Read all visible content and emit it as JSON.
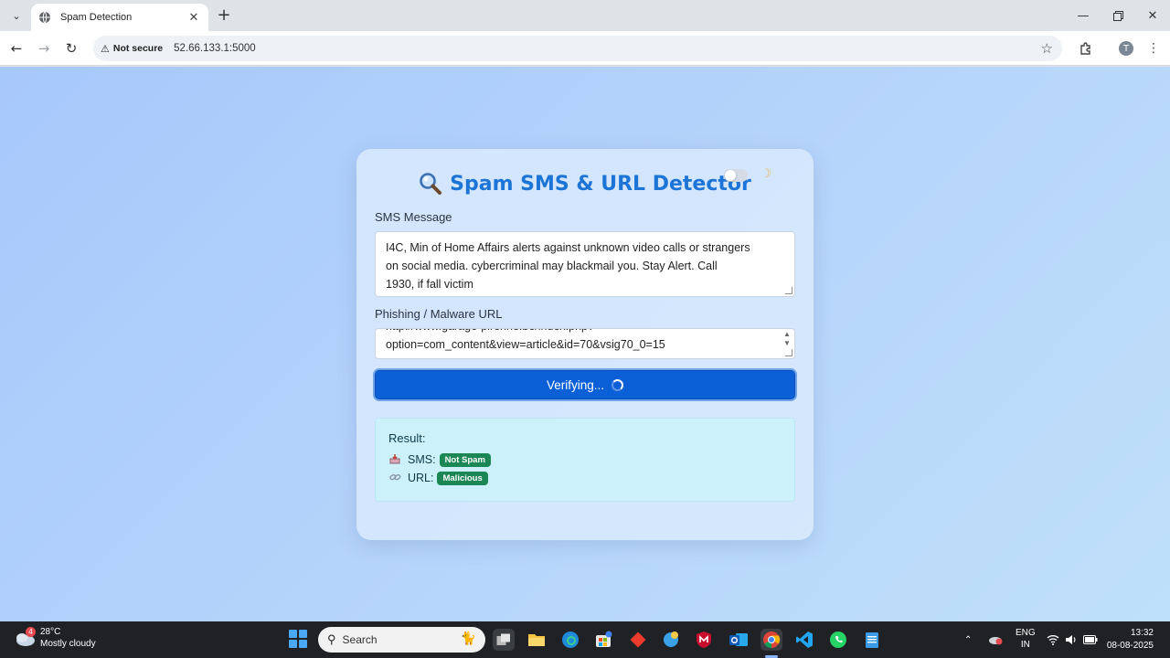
{
  "browser": {
    "tab_title": "Spam Detection",
    "security_label": "Not secure",
    "address": "52.66.133.1:5000",
    "profile_initial": "T"
  },
  "app": {
    "title": "Spam SMS & URL Detector",
    "sms_label": "SMS Message",
    "sms_value_lines": [
      "I4C, Min of Home Affairs alerts against unknown video calls or strangers",
      "on social media. cybercriminal may blackmail you. Stay Alert. Call",
      "1930, if fall victim"
    ],
    "url_label": "Phishing / Malware URL",
    "url_value_lines": [
      "http://www.garage-pirenne.be/index.php?",
      "option=com_content&view=article&id=70&vsig70_0=15"
    ],
    "verify_button_label": "Verifying...",
    "result": {
      "title": "Result:",
      "sms_label": "SMS:",
      "sms_badge": "Not Spam",
      "url_label": "URL:",
      "url_badge": "Malicious"
    }
  },
  "taskbar": {
    "weather_temp": "28°C",
    "weather_desc": "Mostly cloudy",
    "weather_badge": "4",
    "search_placeholder": "Search",
    "lang_top": "ENG",
    "lang_bottom": "IN",
    "time": "13:32",
    "date": "08-08-2025"
  },
  "colors": {
    "accent": "#1c74d6",
    "button": "#0b5fd7",
    "badge": "#1a8754",
    "result_bg": "#cdf1fb"
  }
}
